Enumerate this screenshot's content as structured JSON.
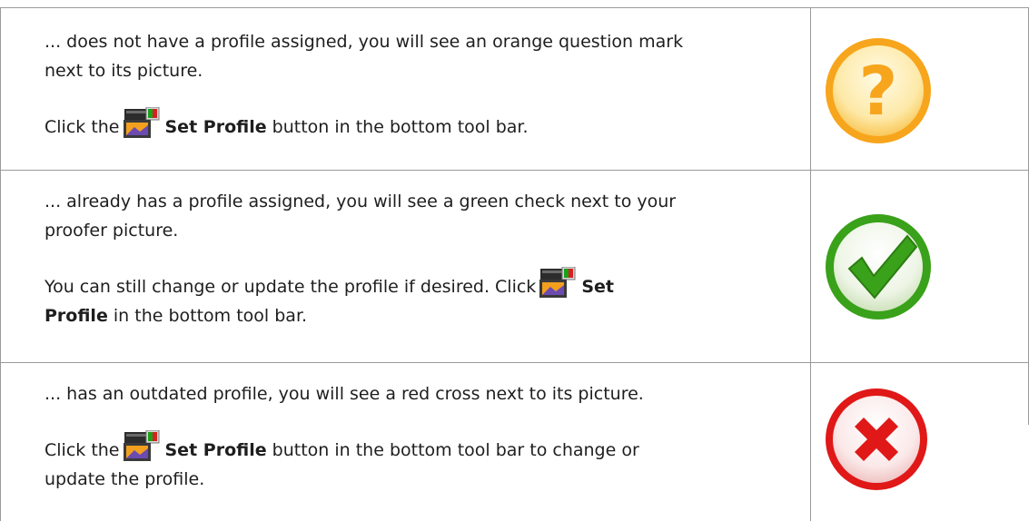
{
  "rows": [
    {
      "status_icon": "orange-question-icon",
      "line1": "... does not have a profile assigned, you will see an orange question mark",
      "line2": "next to its picture.",
      "action_pre": "Click the",
      "action_bold": "Set Profile",
      "action_post": "button in the bottom tool bar."
    },
    {
      "status_icon": "green-check-icon",
      "line1": "... already has a profile assigned, you will see a green check next to your",
      "line2": "proofer picture.",
      "action_pre": "You can still change or update the profile if desired. Click",
      "action_bold1": "Set",
      "action_bold2": "Profile",
      "action_post": "in the bottom tool bar."
    },
    {
      "status_icon": "red-cross-icon",
      "line1": "... has an outdated profile, you will see a red cross next to its picture.",
      "action_pre": "Click the",
      "action_bold": "Set Profile",
      "action_post": "button in the bottom tool bar to change or",
      "action_post2": "update the profile."
    }
  ],
  "colors": {
    "border": "#9a9a9a",
    "text": "#1e1e1e",
    "orange": "#f7a51c",
    "green": "#3aa11a",
    "red": "#e01818"
  },
  "button_icon": "set-profile-icon"
}
